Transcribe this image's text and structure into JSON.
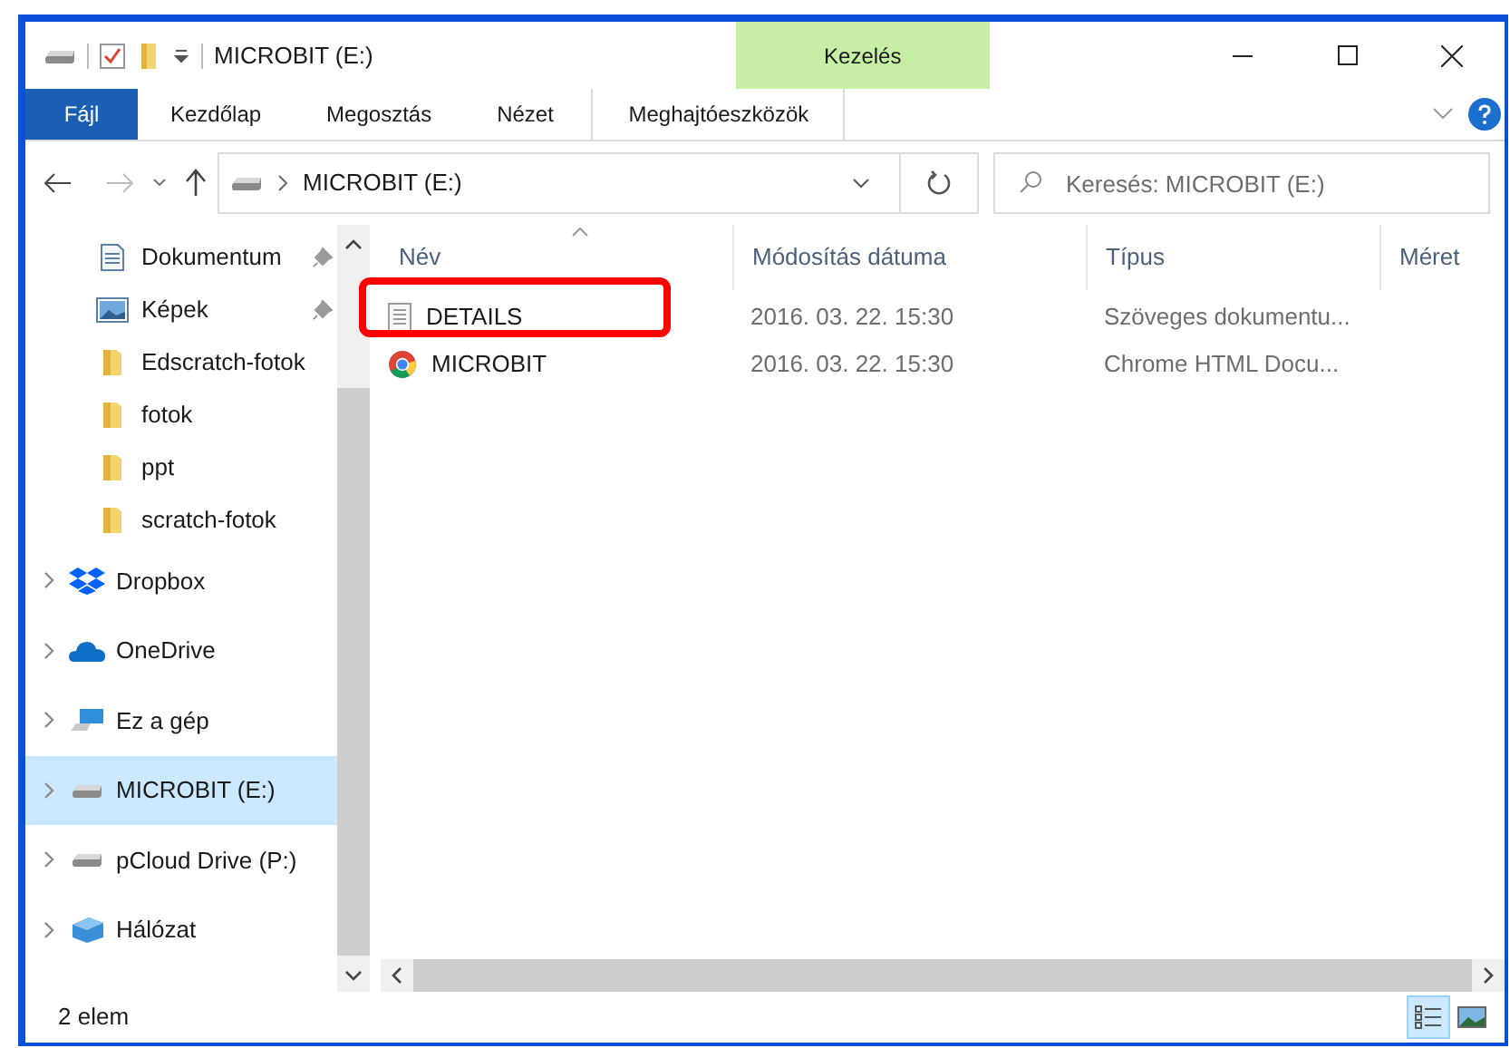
{
  "window": {
    "title": "MICROBIT (E:)",
    "contextual_tab_group": "Kezelés"
  },
  "ribbon_tabs": [
    {
      "label": "Fájl",
      "kind": "file",
      "selected": false
    },
    {
      "label": "Kezdőlap",
      "kind": "tab",
      "selected": false
    },
    {
      "label": "Megosztás",
      "kind": "tab",
      "selected": false
    },
    {
      "label": "Nézet",
      "kind": "tab",
      "selected": false
    },
    {
      "label": "Meghajtóeszközök",
      "kind": "contextual",
      "selected": false
    }
  ],
  "address_bar": {
    "path": [
      "MICROBIT (E:)"
    ]
  },
  "search": {
    "placeholder": "Keresés: MICROBIT (E:)"
  },
  "sidebar": {
    "items": [
      {
        "label": "Dokumentum",
        "kind": "documents",
        "pinned": true,
        "selected": false
      },
      {
        "label": "Képek",
        "kind": "pictures",
        "pinned": true,
        "selected": false
      },
      {
        "label": "Edscratch-fotok",
        "kind": "folder",
        "pinned": false,
        "selected": false
      },
      {
        "label": "fotok",
        "kind": "folder",
        "pinned": false,
        "selected": false
      },
      {
        "label": "ppt",
        "kind": "folder",
        "pinned": false,
        "selected": false
      },
      {
        "label": "scratch-fotok",
        "kind": "folder",
        "pinned": false,
        "selected": false
      },
      {
        "label": "Dropbox",
        "kind": "dropbox",
        "expanded": false,
        "selected": false
      },
      {
        "label": "OneDrive",
        "kind": "onedrive",
        "expanded": false,
        "selected": false
      },
      {
        "label": "Ez a gép",
        "kind": "computer",
        "expanded": false,
        "selected": false
      },
      {
        "label": "MICROBIT (E:)",
        "kind": "drive",
        "expanded": false,
        "selected": true
      },
      {
        "label": "pCloud Drive (P:)",
        "kind": "drive",
        "expanded": false,
        "selected": false
      },
      {
        "label": "Hálózat",
        "kind": "network",
        "expanded": false,
        "selected": false
      }
    ]
  },
  "table": {
    "columns": [
      "Név",
      "Módosítás dátuma",
      "Típus",
      "Méret"
    ],
    "rows": [
      {
        "name": "DETAILS",
        "kind": "text",
        "modified": "2016. 03. 22. 15:30",
        "type": "Szöveges dokumentu...",
        "highlighted": true
      },
      {
        "name": "MICROBIT",
        "kind": "html",
        "modified": "2016. 03. 22. 15:30",
        "type": "Chrome HTML Docu...",
        "highlighted": false
      }
    ]
  },
  "status_bar": {
    "text": "2 elem",
    "views": [
      {
        "kind": "details",
        "selected": true
      },
      {
        "kind": "large",
        "selected": false
      }
    ]
  }
}
